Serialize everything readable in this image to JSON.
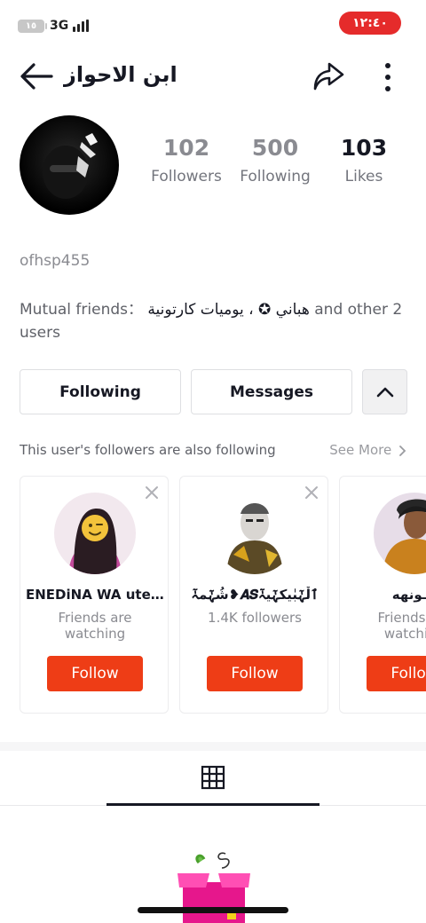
{
  "status_bar": {
    "battery": "١٥",
    "network": "3G",
    "time": "١٢:٤٠"
  },
  "header": {
    "title": "ابن الاحواز"
  },
  "profile": {
    "stats": [
      {
        "value": "102",
        "label": "Followers"
      },
      {
        "value": "500",
        "label": "Following"
      },
      {
        "value": "103",
        "label": "Likes"
      }
    ],
    "username": "ofhsp455",
    "mutual_prefix": "Mutual friends：",
    "mutual_names": "هباني ✪ ، يوميات كارتونية",
    "mutual_suffix": "and other 2 users"
  },
  "actions": {
    "following": "Following",
    "messages": "Messages"
  },
  "suggestions": {
    "title": "This user's followers are also following",
    "see_more": "See More",
    "cards": [
      {
        "name": "ENEDiNA WA ute...",
        "sub": "Friends are watching",
        "follow": "Follow"
      },
      {
        "name": "شُہٰٓمہٰٓ❥𝑨𝑺ٱلْہٰٓبٰيكہٰٓيہٰٓ",
        "sub": "1.4K followers",
        "follow": "Follow"
      },
      {
        "name": "ـنـونهه",
        "sub": "Friends are watching",
        "follow": "Follow"
      }
    ]
  },
  "colors": {
    "follow_button": "#ee3d16",
    "time_pill": "#e52b2b",
    "muted_text": "#8a8b91"
  },
  "icons": [
    "back-arrow-icon",
    "share-icon",
    "more-vertical-icon",
    "chevron-up-icon",
    "close-icon",
    "chevron-right-icon",
    "grid-icon"
  ]
}
